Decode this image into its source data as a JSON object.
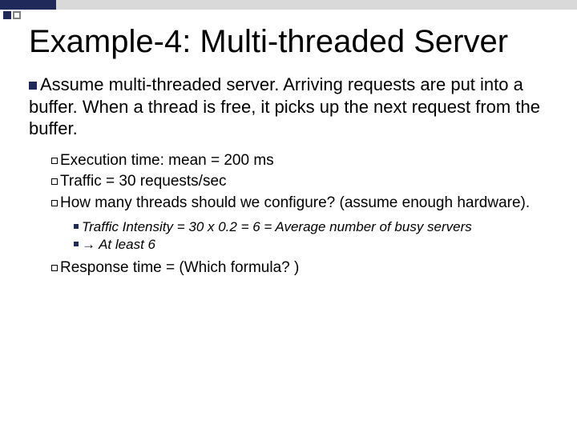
{
  "title": "Example-4: Multi-threaded Server",
  "main_point": "Assume multi-threaded server. Arriving requests are put into a buffer. When a thread is free, it picks up the next request from the buffer.",
  "sub_points": {
    "exec_time": "Execution time: mean = 200 ms",
    "traffic": "Traffic = 30 requests/sec",
    "question": "How many threads should we configure? (assume enough hardware).",
    "answer1": "Traffic Intensity = 30 x 0.2 = 6 = Average number of busy servers",
    "answer2": "→ At least 6",
    "response": "Response time = (Which formula? )"
  }
}
